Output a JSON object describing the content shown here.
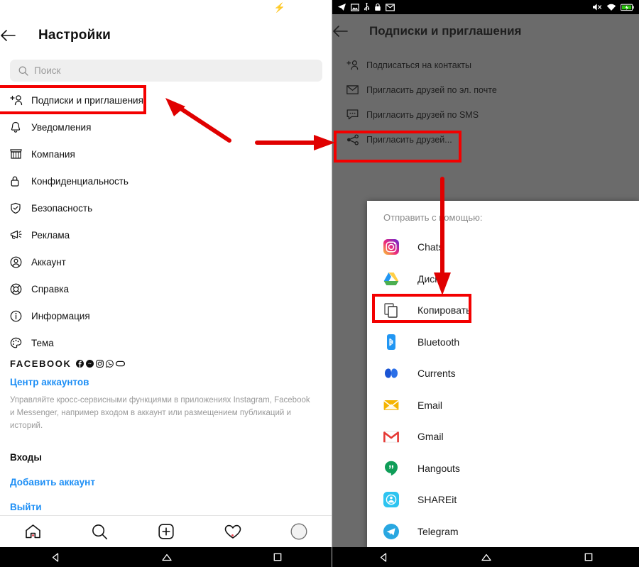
{
  "left_phone": {
    "status_bar": {
      "charge_icon": "bolt-green-icon"
    },
    "header": {
      "back_icon": "back-arrow-icon",
      "title": "Настройки"
    },
    "search": {
      "icon": "search-icon",
      "placeholder": "Поиск",
      "value": ""
    },
    "settings_items": [
      {
        "icon": "add-person-icon",
        "label": "Подписки и приглашения",
        "highlighted": true
      },
      {
        "icon": "bell-icon",
        "label": "Уведомления"
      },
      {
        "icon": "store-icon",
        "label": "Компания"
      },
      {
        "icon": "lock-icon",
        "label": "Конфиденциальность"
      },
      {
        "icon": "shield-check-icon",
        "label": "Безопасность"
      },
      {
        "icon": "megaphone-icon",
        "label": "Реклама"
      },
      {
        "icon": "account-circle-icon",
        "label": "Аккаунт"
      },
      {
        "icon": "lifebuoy-icon",
        "label": "Справка"
      },
      {
        "icon": "info-circle-icon",
        "label": "Информация"
      },
      {
        "icon": "palette-icon",
        "label": "Тема"
      }
    ],
    "facebook_block": {
      "brand_word": "FACEBOOK",
      "brand_icons": [
        "facebook-icon",
        "messenger-icon",
        "instagram-icon",
        "whatsapp-icon",
        "oculus-icon"
      ],
      "accounts_center_link": "Центр аккаунтов",
      "description": "Управляйте кросс-сервисными функциями в приложениях Instagram, Facebook и Messenger, например входом в аккаунт или размещением публикаций и историй.",
      "logins_heading": "Входы",
      "add_account_link": "Добавить аккаунт",
      "logout_link": "Выйти"
    },
    "tabbar": [
      {
        "icon": "home-icon",
        "badge": true
      },
      {
        "icon": "search-icon",
        "badge": false
      },
      {
        "icon": "add-post-icon",
        "badge": false
      },
      {
        "icon": "heart-icon",
        "badge": true
      },
      {
        "icon": "profile-avatar-icon",
        "badge": false
      }
    ],
    "navbar": [
      "back-triangle-icon",
      "home-pentagon-icon",
      "recents-square-icon"
    ]
  },
  "right_phone": {
    "status_bar": {
      "left_icons": [
        "telegram-icon",
        "screenshot-icon",
        "usb-icon",
        "lock-icon",
        "gmail-icon"
      ],
      "right_icons": [
        "mute-icon",
        "wifi-icon",
        "battery-charging-icon"
      ]
    },
    "header": {
      "back_icon": "back-arrow-icon",
      "title": "Подписки и приглашения"
    },
    "invite_items": [
      {
        "icon": "add-person-icon",
        "label": "Подписаться на контакты",
        "highlighted": false
      },
      {
        "icon": "envelope-icon",
        "label": "Пригласить друзей по эл. почте",
        "highlighted": false
      },
      {
        "icon": "sms-bubble-icon",
        "label": "Пригласить друзей по SMS",
        "highlighted": false
      },
      {
        "icon": "share-nodes-icon",
        "label": "Пригласить друзей...",
        "highlighted": true
      }
    ],
    "share_sheet": {
      "title": "Отправить с помощью:",
      "apps": [
        {
          "icon": "instagram-icon",
          "label": "Chats",
          "highlighted": false
        },
        {
          "icon": "google-drive-icon",
          "label": "Диск",
          "highlighted": false
        },
        {
          "icon": "copy-icon",
          "label": "Копировать",
          "highlighted": true
        },
        {
          "icon": "bluetooth-icon",
          "label": "Bluetooth",
          "highlighted": false
        },
        {
          "icon": "currents-icon",
          "label": "Currents",
          "highlighted": false
        },
        {
          "icon": "email-icon",
          "label": "Email",
          "highlighted": false
        },
        {
          "icon": "gmail-icon",
          "label": "Gmail",
          "highlighted": false
        },
        {
          "icon": "hangouts-icon",
          "label": "Hangouts",
          "highlighted": false
        },
        {
          "icon": "shareit-icon",
          "label": "SHAREit",
          "highlighted": false
        },
        {
          "icon": "telegram-icon",
          "label": "Telegram",
          "highlighted": false
        }
      ]
    },
    "navbar": [
      "back-triangle-icon",
      "home-pentagon-icon",
      "recents-square-icon"
    ]
  },
  "annotations": {
    "accent_color": "#f30000",
    "boxes": [
      {
        "name": "highlight-box-subscriptions"
      },
      {
        "name": "highlight-box-invite-friends"
      },
      {
        "name": "highlight-box-copy"
      }
    ],
    "arrows": [
      {
        "name": "arrow-to-subscriptions"
      },
      {
        "name": "arrow-to-invite-friends"
      },
      {
        "name": "arrow-to-copy"
      }
    ]
  }
}
